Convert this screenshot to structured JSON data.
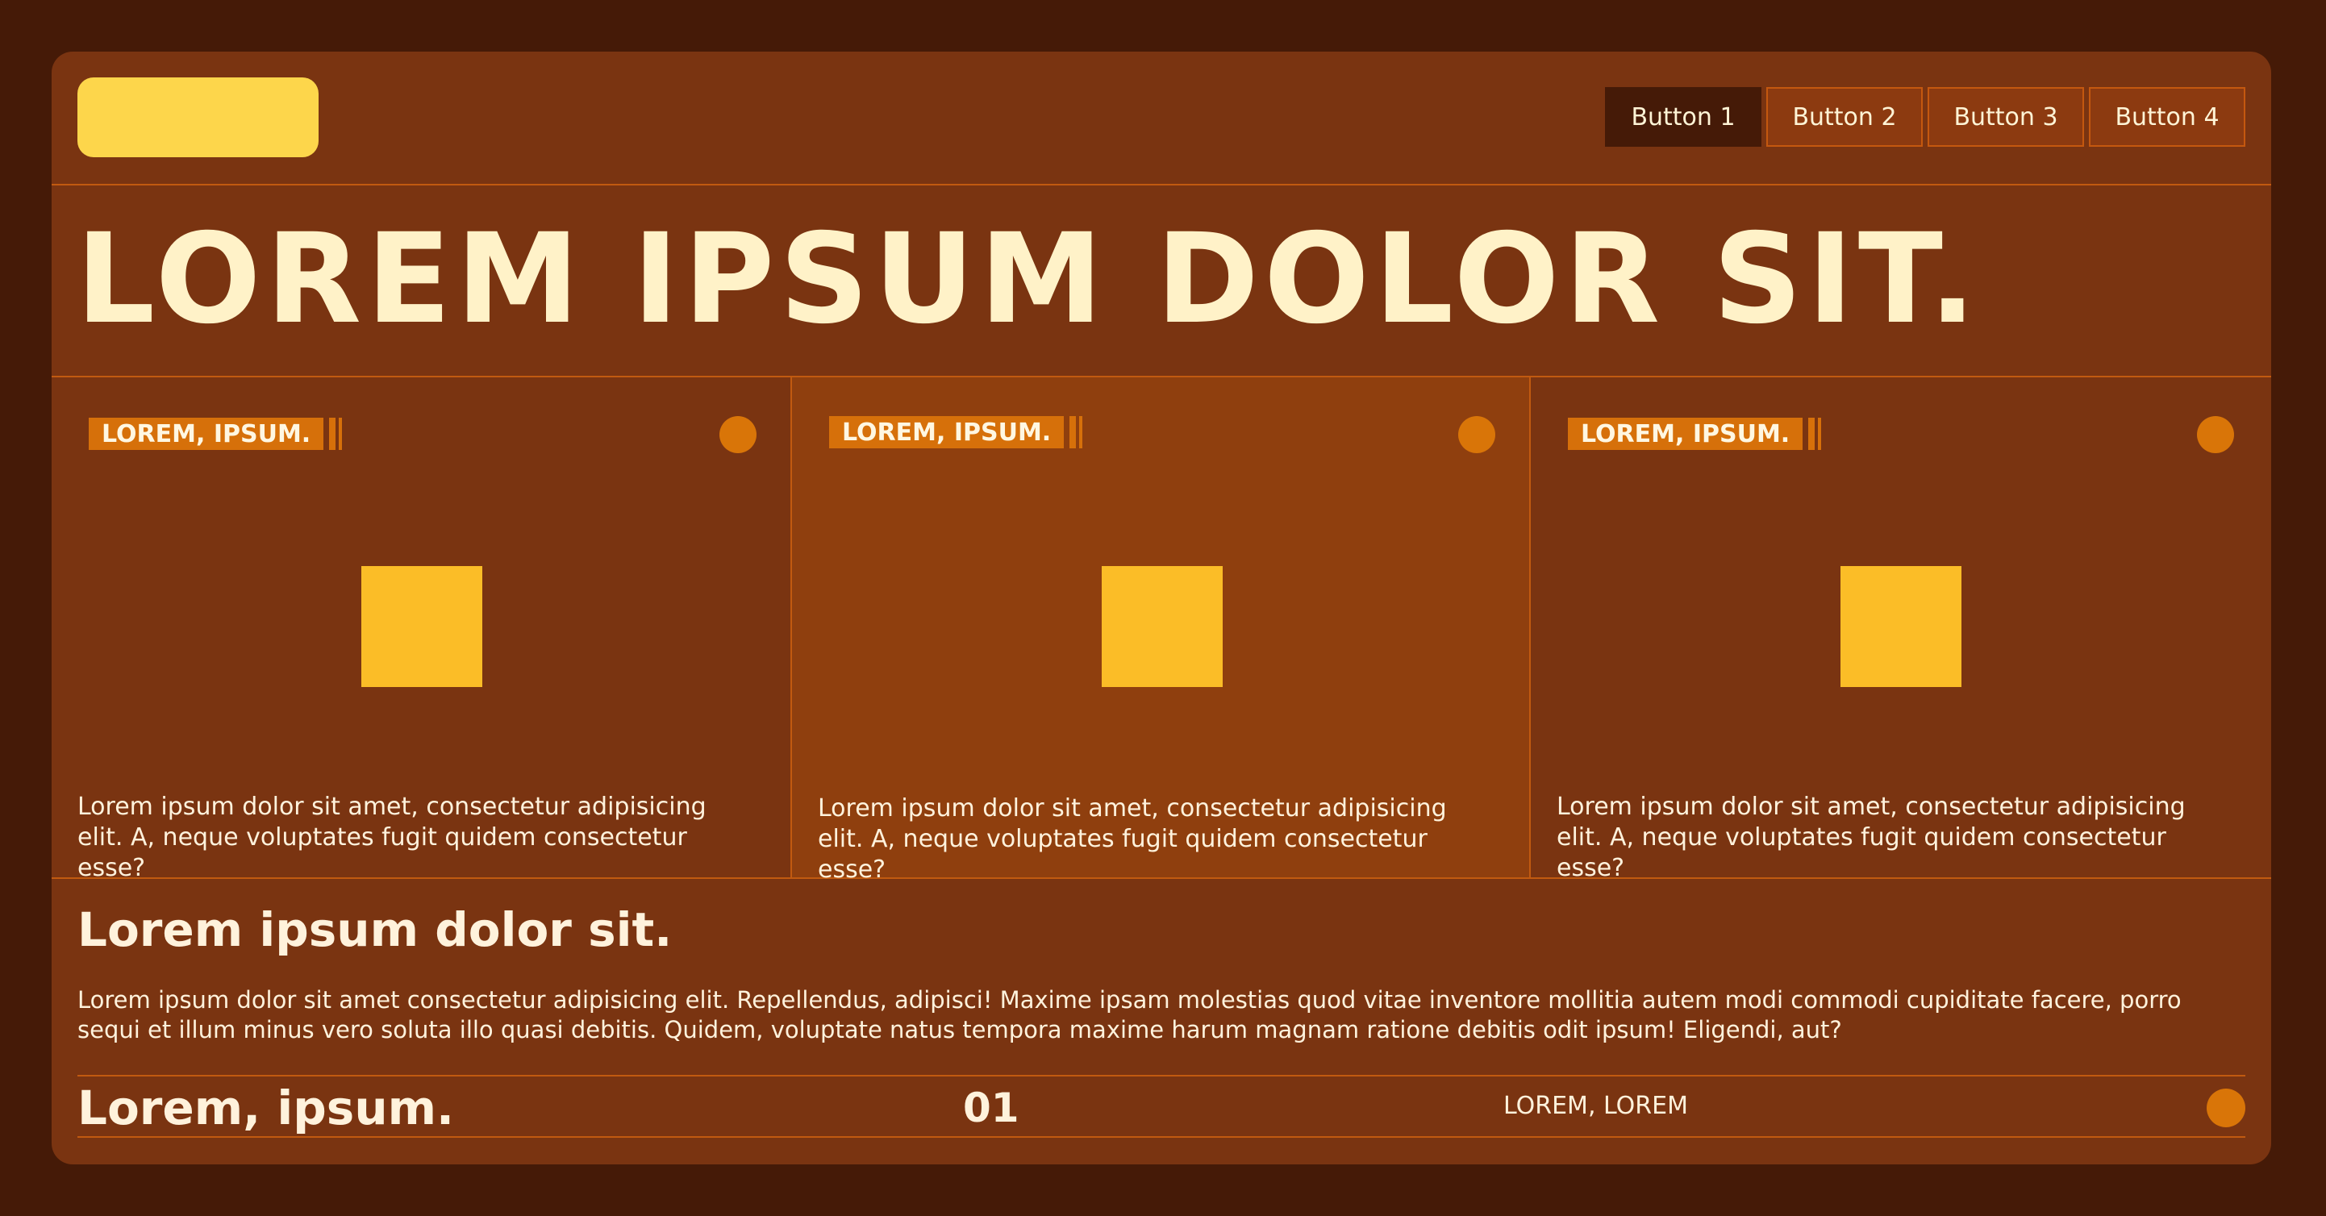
{
  "nav": {
    "buttons": [
      "Button 1",
      "Button 2",
      "Button 3",
      "Button 4"
    ],
    "active_index": 0
  },
  "hero": {
    "title": "LOREM IPSUM DOLOR SIT."
  },
  "cards": [
    {
      "tag": "LOREM, IPSUM.",
      "text": "Lorem ipsum dolor sit amet, consectetur adipisicing elit. A, neque voluptates fugit quidem consectetur esse?"
    },
    {
      "tag": "LOREM, IPSUM.",
      "text": "Lorem ipsum dolor sit amet, consectetur adipisicing elit. A, neque voluptates fugit quidem consectetur esse?"
    },
    {
      "tag": "LOREM, IPSUM.",
      "text": "Lorem ipsum dolor sit amet, consectetur adipisicing elit. A, neque voluptates fugit quidem consectetur esse?"
    }
  ],
  "section": {
    "heading": "Lorem ipsum dolor sit.",
    "paragraph": "Lorem ipsum dolor sit amet consectetur adipisicing elit. Repellendus, adipisci! Maxime ipsam molestias quod vitae inventore mollitia autem modi commodi cupiditate facere, porro sequi et illum minus vero soluta illo quasi debitis. Quidem, voluptate natus tempora maxime harum magnam ratione debitis odit ipsum! Eligendi, aut?"
  },
  "footer": {
    "title": "Lorem, ipsum.",
    "number": "01",
    "label": "LOREM, LOREM"
  },
  "colors": {
    "page_background": "#451a07",
    "panel": "#7a3411",
    "panel_highlight": "#8f3f0e",
    "accent_orange": "#d6700a",
    "accent_yellow": "#fbbd27",
    "logo_yellow": "#fdd64b",
    "text_cream": "#fff2c8"
  }
}
